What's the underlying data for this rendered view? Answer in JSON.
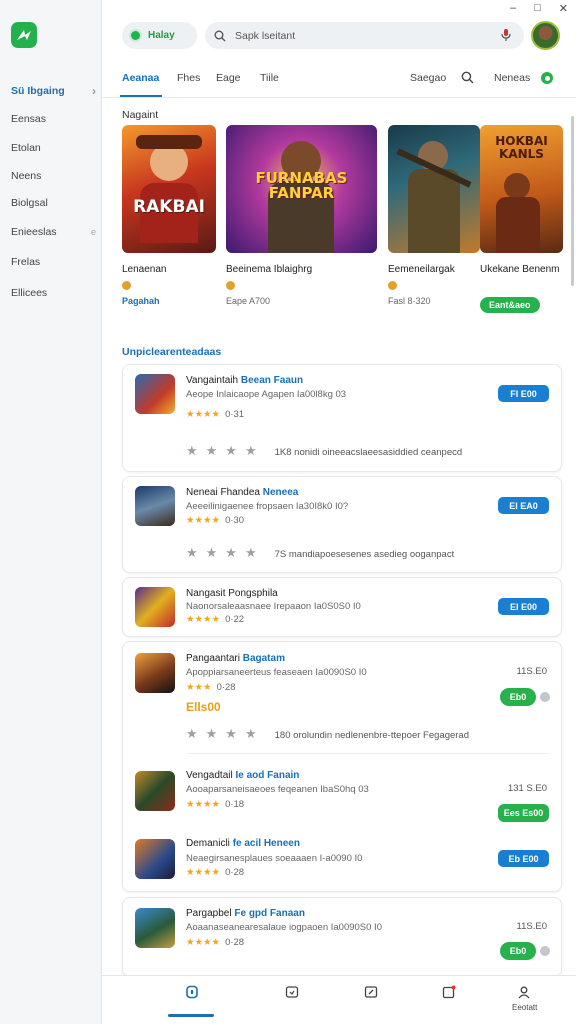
{
  "window": {
    "minimize": "–",
    "maximize": "□",
    "close": "✕"
  },
  "sidebar": {
    "items": [
      {
        "label": "Sü Ibgaing"
      },
      {
        "label": "Eensas"
      },
      {
        "label": "Etolan"
      },
      {
        "label": "Neens"
      },
      {
        "label": "Biolgsal"
      },
      {
        "label": "Enieeslas",
        "sub": "e"
      },
      {
        "label": "Frelas"
      },
      {
        "label": "Ellicees"
      }
    ]
  },
  "topbar": {
    "status_label": "Halay",
    "search_placeholder": "Sapk lseitant"
  },
  "tabs": {
    "items": [
      "Aeanaa",
      "Fhes",
      "Eage",
      "Tiile"
    ],
    "right_items": [
      "Saegao",
      "Neneas"
    ]
  },
  "featured": {
    "title": "Nagaint",
    "cards": [
      {
        "art_text": "RAKBAI",
        "name": "Lenaenan",
        "sub": "Pagahah",
        "sub_type": "link"
      },
      {
        "art_text": "FURNABAS FANPAR",
        "name": "Beeinema Iblaighrg",
        "meta": "Eape A700",
        "sub_type": "none"
      },
      {
        "art_text": "",
        "name": "Eemeneilargak",
        "meta": "Fasl 8·320",
        "sub_type": "none"
      },
      {
        "art_text": "HOKBAI KANLS",
        "name": "Ukekane Benenm",
        "sub": "Eant&aeo",
        "sub_type": "pill"
      }
    ]
  },
  "list": {
    "title": "Unpiclearenteadaas",
    "rows": [
      {
        "title": "Vangaintaih",
        "title_hl": "Beean Faaun",
        "desc": "Aeope Inlaicaope Agapen Ia00l8kg 03",
        "rating": "0·31",
        "reviews": "1K8 nonidi oineeacslaeesasiddied ceanpecd",
        "button": "Fl E00"
      },
      {
        "title": "Neneai Fhandea",
        "title_hl": "Neneea",
        "desc": "Aeeeilinigaenee fropsaen Ia30I8k0 I0?",
        "rating": "0·30",
        "reviews": "7S mandiapoesesenes asedieg ooganpact",
        "button": "El EA0"
      },
      {
        "title": "Nangasit Pongsphila",
        "title_hl": "",
        "desc": "Naonorsaleaasnaee Irepaaon Ia0S0S0 I0",
        "rating": "0·22",
        "button": "El E00"
      },
      {
        "title": "Pangaantari",
        "title_hl": "Bagatam",
        "desc": "Apoppiarsaneerteus feaseaen Ia0090S0 I0",
        "rating": "0·28",
        "price_tag": "Ells00",
        "price": "11S.E0",
        "button": "Eb0",
        "reviews": "180 orolundin nedlenenbre-ttepoer Fegagerad"
      },
      {
        "title": "Vengadtail",
        "title_hl": "Ie aod Fanain",
        "desc": "Aooaparsaneisaeoes feqeanen IbaS0hq 03",
        "rating": "0·18",
        "price": "131 S.E0",
        "button": "Ees Es00"
      },
      {
        "title": "Demanicli",
        "title_hl": "fe acil Heneen",
        "desc": "Neaegirsanesplaues soeaaaen I-a0090 I0",
        "rating": "0·28",
        "button": "Eb E00"
      },
      {
        "title": "Pargapbel",
        "title_hl": "Fe gpd Fanaan",
        "desc": "Aoaanaseanearesalaue iogpaoen Ia0090S0 I0",
        "rating": "0·28",
        "price": "11S.E0",
        "button": "Eb0"
      }
    ]
  },
  "bottom_nav": {
    "account_label": "Eeotatt"
  },
  "colors": {
    "accent": "#1a6fb5",
    "brand_green": "#23b14d",
    "star": "#f2a71b"
  }
}
